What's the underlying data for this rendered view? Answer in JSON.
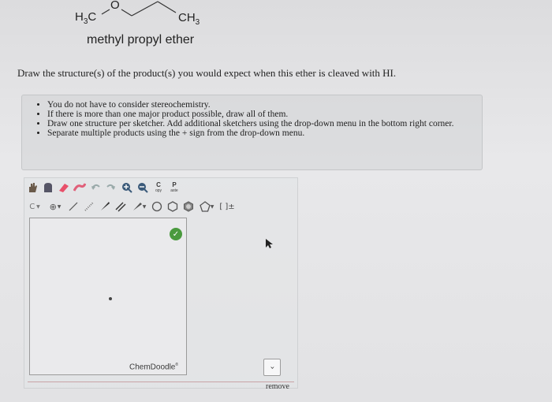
{
  "molecule": {
    "left_label": "H3C",
    "oxygen_label": "O",
    "right_label": "CH3"
  },
  "compound_name": "methyl propyl ether",
  "question": "Draw the structure(s) of the product(s) you would expect when this ether is cleaved with HI.",
  "instructions": [
    "You do not have to consider stereochemistry.",
    "If there is more than one major product possible, draw all of them.",
    "Draw one structure per sketcher. Add additional sketchers using the drop-down menu in the bottom right corner.",
    "Separate multiple products using the + sign from the drop-down menu."
  ],
  "toolbar": {
    "copy_letter": "C",
    "copy_small": "opy",
    "paste_letter": "P",
    "paste_small": "aste",
    "element_selector": "C",
    "charge_label": "[ ]±"
  },
  "sketcher": {
    "brand": "ChemDoodle",
    "dropdown_symbol": "›",
    "remove_label": "remove"
  },
  "colors": {
    "check_green": "#4a9a3e",
    "divider": "#c9a3a6"
  }
}
